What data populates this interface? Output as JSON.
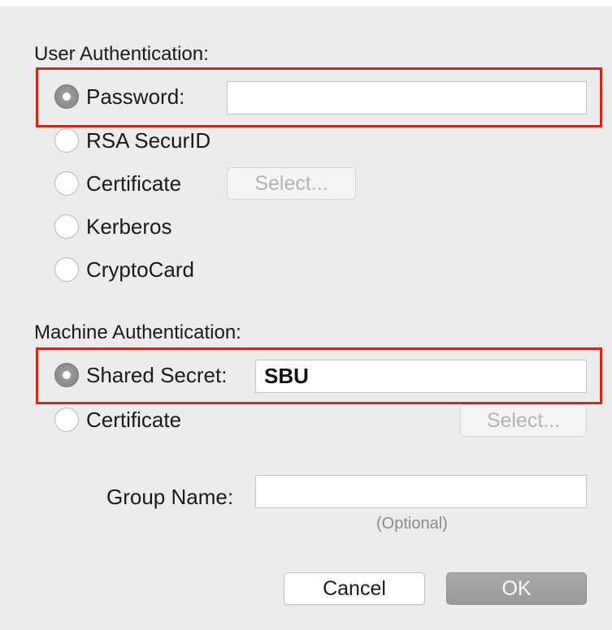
{
  "user_auth": {
    "label": "User Authentication:",
    "options": [
      {
        "label": "Password:",
        "selected": true
      },
      {
        "label": "RSA SecurID",
        "selected": false
      },
      {
        "label": "Certificate",
        "selected": false
      },
      {
        "label": "Kerberos",
        "selected": false
      },
      {
        "label": "CryptoCard",
        "selected": false
      }
    ],
    "password_value": "",
    "certificate_select_label": "Select..."
  },
  "machine_auth": {
    "label": "Machine Authentication:",
    "options": [
      {
        "label": "Shared Secret:",
        "selected": true
      },
      {
        "label": "Certificate",
        "selected": false
      }
    ],
    "shared_secret_value": "SBU",
    "certificate_select_label": "Select..."
  },
  "group": {
    "label": "Group Name:",
    "value": "",
    "hint": "(Optional)"
  },
  "buttons": {
    "cancel_label": "Cancel",
    "ok_label": "OK"
  },
  "colors": {
    "highlight": "#d0281e",
    "background": "#ececec"
  }
}
